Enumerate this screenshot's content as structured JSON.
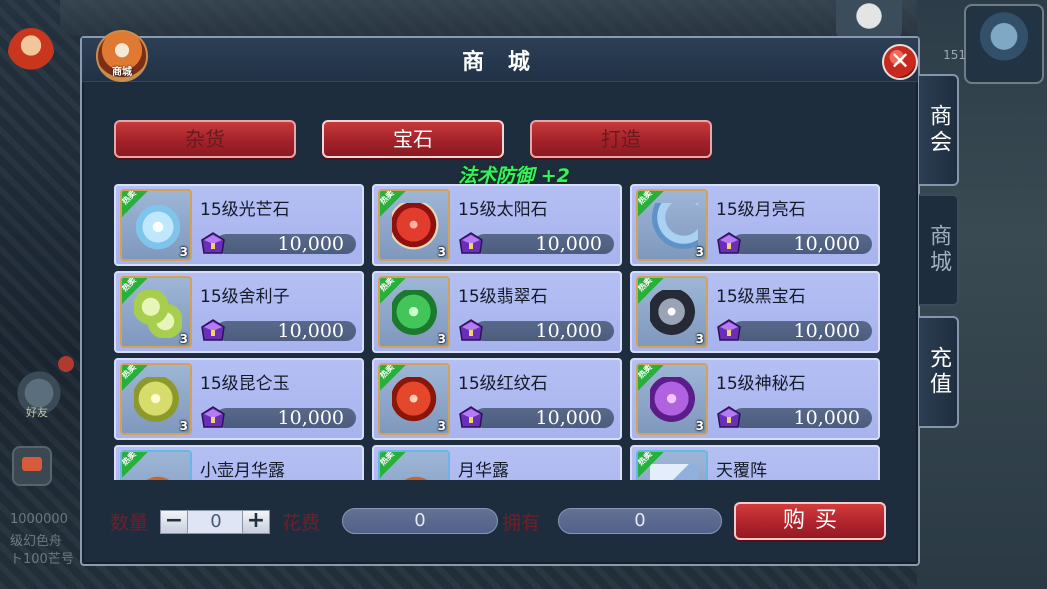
{
  "dialog": {
    "title": "商 城",
    "logo_label": "商城",
    "close_label": "✕"
  },
  "background": {
    "level_number": "151",
    "friend_label": "好友",
    "chat_lines": [
      "1000000",
      "级幻色舟",
      "ト100芒号"
    ]
  },
  "category_tabs": [
    {
      "label": "杂货",
      "active": false
    },
    {
      "label": "宝石",
      "active": true
    },
    {
      "label": "打造",
      "active": false
    }
  ],
  "bonus_text": "法术防御 +2",
  "items": [
    {
      "name": "15级光芒石",
      "price": "10,000",
      "qty": "3",
      "hot": "热卖",
      "gem": "star-crystal-gem"
    },
    {
      "name": "15级太阳石",
      "price": "10,000",
      "qty": "3",
      "hot": "热卖",
      "gem": "red-sun-gem"
    },
    {
      "name": "15级月亮石",
      "price": "10,000",
      "qty": "3",
      "hot": "热卖",
      "gem": "crescent-moon-gem"
    },
    {
      "name": "15级舍利子",
      "price": "10,000",
      "qty": "3",
      "hot": "热卖",
      "gem": "green-pearls-gem"
    },
    {
      "name": "15级翡翠石",
      "price": "10,000",
      "qty": "3",
      "hot": "热卖",
      "gem": "jade-gem"
    },
    {
      "name": "15级黑宝石",
      "price": "10,000",
      "qty": "3",
      "hot": "热卖",
      "gem": "black-gem"
    },
    {
      "name": "15级昆仑玉",
      "price": "10,000",
      "qty": "3",
      "hot": "热卖",
      "gem": "kunlun-jade-gem"
    },
    {
      "name": "15级红纹石",
      "price": "10,000",
      "qty": "3",
      "hot": "热卖",
      "gem": "red-stripe-gem"
    },
    {
      "name": "15级神秘石",
      "price": "10,000",
      "qty": "3",
      "hot": "热卖",
      "gem": "mystery-gem"
    },
    {
      "name": "小壶月华露",
      "price": "",
      "qty": "",
      "hot": "热卖",
      "gem": "small-dew-pot"
    },
    {
      "name": "月华露",
      "price": "",
      "qty": "",
      "hot": "热卖",
      "gem": "dew-pot"
    },
    {
      "name": "天覆阵",
      "price": "",
      "qty": "",
      "hot": "热卖",
      "gem": "formation-book"
    }
  ],
  "bottom": {
    "qty_label": "数量",
    "qty_value": "0",
    "minus": "−",
    "plus": "+",
    "cost_label": "花费",
    "cost_value": "0",
    "own_label": "拥有",
    "own_value": "0",
    "buy_label": "购买"
  },
  "side_tabs": [
    {
      "label": "商会",
      "active": false
    },
    {
      "label": "商城",
      "active": true
    },
    {
      "label": "充值",
      "active": false
    }
  ],
  "colors": {
    "dialog_bg": "#1e2d3e",
    "card_bg": "#b4bff3",
    "tab_red": "#a3222a",
    "bonus_green": "#37f25e",
    "price_bar": "#52618a"
  }
}
